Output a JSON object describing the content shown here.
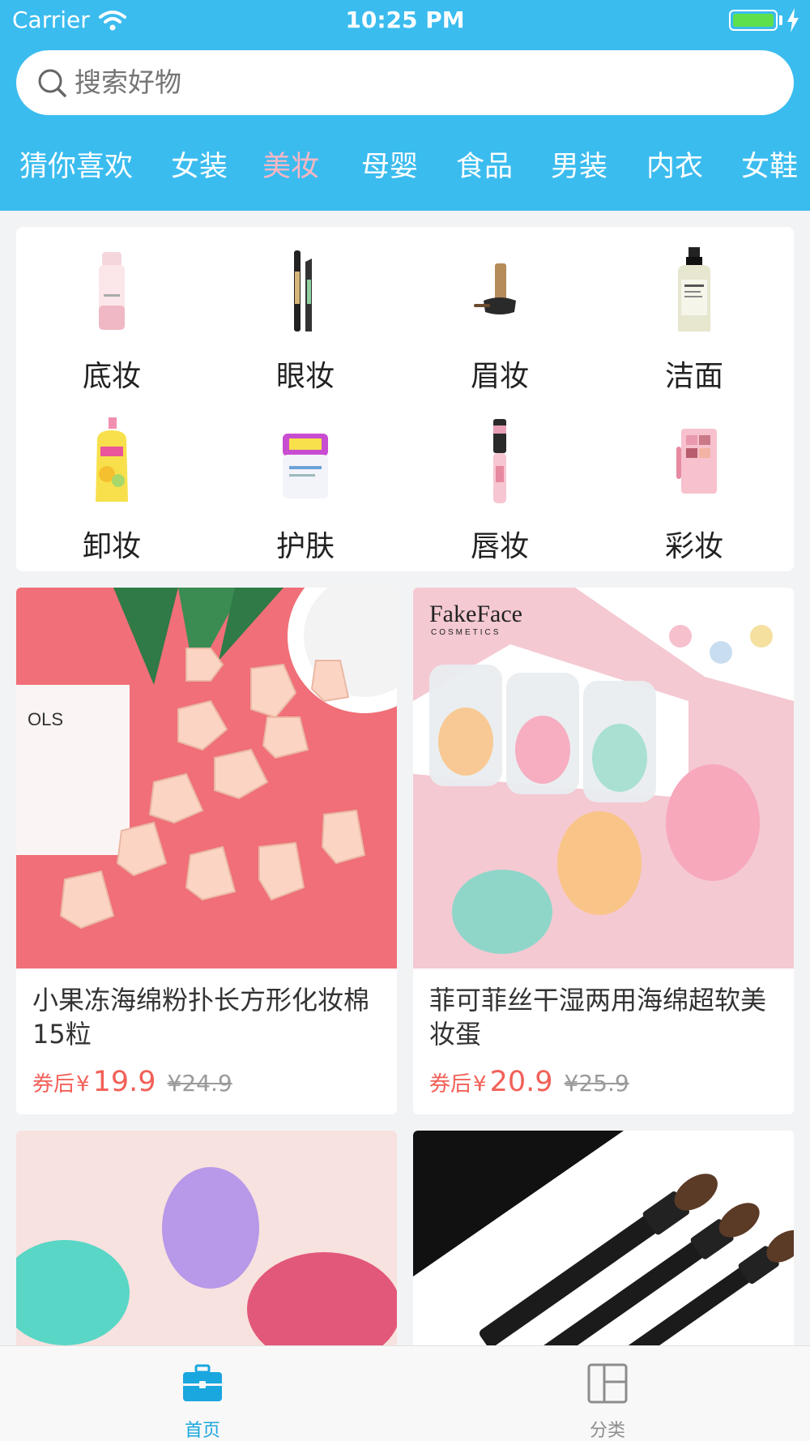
{
  "status_bar": {
    "carrier": "Carrier",
    "time": "10:25 PM"
  },
  "search": {
    "placeholder": "搜索好物"
  },
  "tabs": [
    {
      "label": "猜你喜欢"
    },
    {
      "label": "女装"
    },
    {
      "label": "美妆"
    },
    {
      "label": "母婴"
    },
    {
      "label": "食品"
    },
    {
      "label": "男装"
    },
    {
      "label": "内衣"
    },
    {
      "label": "女鞋"
    }
  ],
  "active_tab": "美妆",
  "categories": [
    {
      "label": "底妆",
      "icon": "foundation-bottle-icon"
    },
    {
      "label": "眼妆",
      "icon": "eyeliner-icon"
    },
    {
      "label": "眉妆",
      "icon": "brow-mascara-icon"
    },
    {
      "label": "洁面",
      "icon": "cleanser-bottle-icon"
    },
    {
      "label": "卸妆",
      "icon": "makeup-remover-bottle-icon"
    },
    {
      "label": "护肤",
      "icon": "skincare-jar-icon"
    },
    {
      "label": "唇妆",
      "icon": "lip-gloss-icon"
    },
    {
      "label": "彩妆",
      "icon": "eyeshadow-palette-icon"
    }
  ],
  "products": [
    {
      "title": "小果冻海绵粉扑长方形化妆棉15粒",
      "coupon_label": "券后",
      "currency": "¥",
      "price": "19.9",
      "original_price": "¥24.9"
    },
    {
      "title": "菲可菲丝干湿两用海绵超软美妆蛋",
      "coupon_label": "券后",
      "currency": "¥",
      "price": "20.9",
      "original_price": "¥25.9"
    },
    {
      "title": "",
      "coupon_label": "",
      "currency": "",
      "price": "",
      "original_price": ""
    },
    {
      "title": "",
      "coupon_label": "",
      "currency": "",
      "price": "",
      "original_price": ""
    }
  ],
  "product_image_text": {
    "p1_jar_text": "OLS",
    "p2_brand": "FakeFace",
    "p2_brand_sub": "COSMETICS"
  },
  "tabbar": [
    {
      "label": "首页",
      "icon": "briefcase-icon",
      "active": true
    },
    {
      "label": "分类",
      "icon": "category-grid-icon",
      "active": false
    }
  ],
  "colors": {
    "header_bg": "#3bbcef",
    "active_tab": "#ffb6c1",
    "price": "#f26058",
    "tabbar_active": "#1aa6de"
  }
}
